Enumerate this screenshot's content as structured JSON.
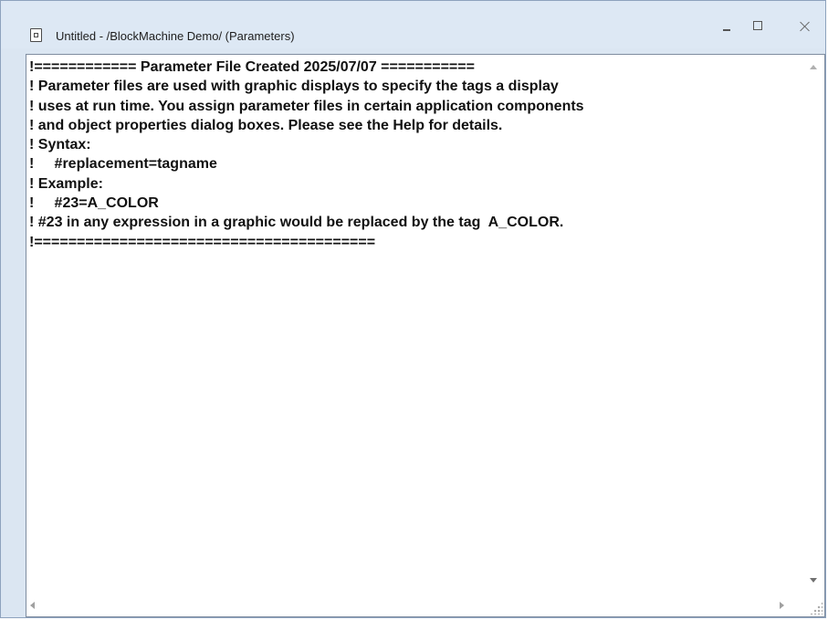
{
  "window": {
    "title": "Untitled - /BlockMachine Demo/ (Parameters)",
    "controls": {
      "minimize": "minimize-icon",
      "maximize": "maximize-icon",
      "close": "close-icon"
    }
  },
  "editor": {
    "lines": [
      "!============ Parameter File Created 2025/07/07 ===========",
      "! Parameter files are used with graphic displays to specify the tags a display",
      "! uses at run time. You assign parameter files in certain application components",
      "! and object properties dialog boxes. Please see the Help for details.",
      "! Syntax:",
      "!     #replacement=tagname",
      "! Example:",
      "!     #23=A_COLOR",
      "! #23 in any expression in a graphic would be replaced by the tag  A_COLOR.",
      "!========================================"
    ]
  }
}
